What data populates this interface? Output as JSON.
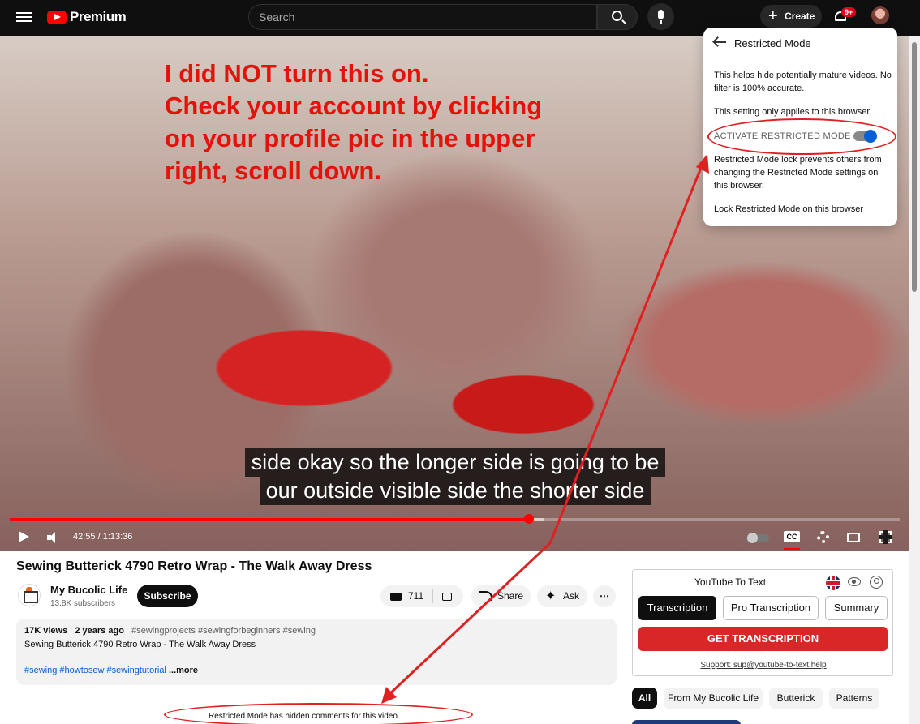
{
  "header": {
    "logo_text": "Premium",
    "search_placeholder": "Search",
    "create_label": "Create",
    "notification_badge": "9+"
  },
  "video": {
    "overlay_lines": [
      "I did NOT turn this on.",
      "Check your account by clicking",
      "on your profile pic in the upper",
      "right, scroll down."
    ],
    "caption_lines": [
      "side okay so the longer side is going to be",
      "our outside visible side the shorter side"
    ],
    "time": "42:55 / 1:13:36",
    "progress_fraction": 0.583,
    "buffered_fraction": 0.601,
    "cc_label": "CC"
  },
  "restricted_menu": {
    "title": "Restricted Mode",
    "description": "This helps hide potentially mature videos. No filter is 100% accurate.",
    "browser_note": "This setting only applies to this browser.",
    "toggle_label": "ACTIVATE RESTRICTED MODE",
    "toggle_on": true,
    "lock_note": "Restricted Mode lock prevents others from changing the Restricted Mode settings on this browser.",
    "lock_link": "Lock Restricted Mode on this browser"
  },
  "info": {
    "title": "Sewing Butterick 4790 Retro Wrap - The Walk Away Dress",
    "channel": "My Bucolic Life",
    "subscribers": "13.8K subscribers",
    "subscribe_label": "Subscribe",
    "likes": "711",
    "share_label": "Share",
    "ask_label": "Ask",
    "more_icon": "⋯"
  },
  "description": {
    "views": "17K views",
    "age": "2 years ago",
    "tags_top": "#sewingprojects #sewingforbeginners #sewing",
    "line2": "Sewing Butterick 4790 Retro Wrap  - The Walk Away Dress",
    "hashtags": "#sewing #howtosew #sewingtutorial",
    "more": "...more"
  },
  "comments": {
    "hidden_notice": "Restricted Mode has hidden comments for this video."
  },
  "yt_to_text": {
    "title": "YouTube To Text",
    "tabs": [
      "Transcription",
      "Pro Transcription",
      "Summary"
    ],
    "get_button": "GET TRANSCRIPTION",
    "support": "Support: sup@youtube-to-text.help"
  },
  "chips": [
    "All",
    "From My Bucolic Life",
    "Butterick",
    "Patterns"
  ],
  "colors": {
    "annotation_red": "#e02121",
    "toggle_blue": "#065fd4",
    "youtube_red": "#ff0000"
  }
}
